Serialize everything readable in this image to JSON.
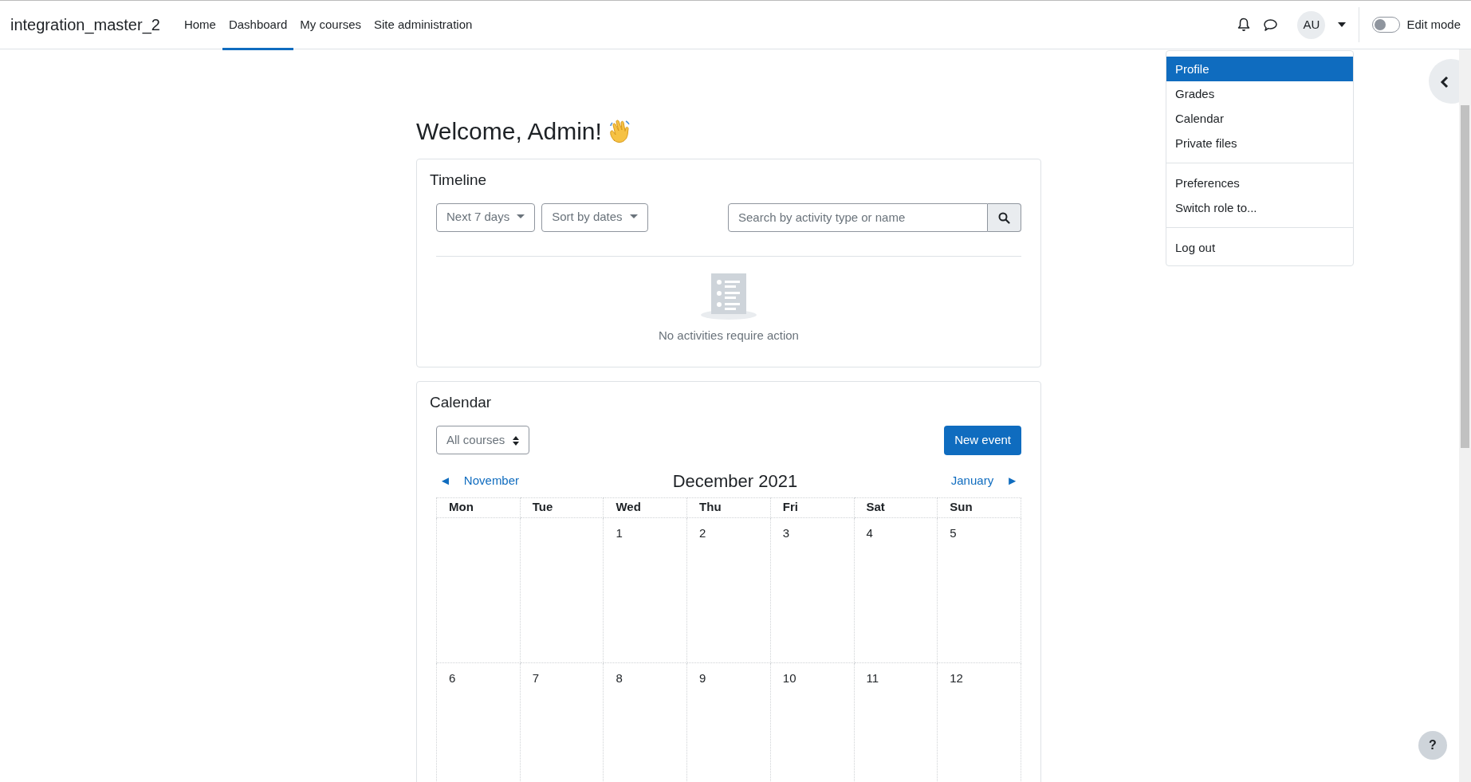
{
  "site_name": "integration_master_2",
  "nav": [
    {
      "label": "Home",
      "selected": false
    },
    {
      "label": "Dashboard",
      "selected": true
    },
    {
      "label": "My courses",
      "selected": false
    },
    {
      "label": "Site administration",
      "selected": false
    }
  ],
  "user": {
    "initials": "AU"
  },
  "edit_mode": {
    "label": "Edit mode",
    "on": false
  },
  "user_menu": {
    "groups": [
      [
        {
          "label": "Profile",
          "selected": true
        },
        {
          "label": "Grades",
          "selected": false
        },
        {
          "label": "Calendar",
          "selected": false
        },
        {
          "label": "Private files",
          "selected": false
        }
      ],
      [
        {
          "label": "Preferences",
          "selected": false
        },
        {
          "label": "Switch role to...",
          "selected": false
        }
      ],
      [
        {
          "label": "Log out",
          "selected": false
        }
      ]
    ]
  },
  "welcome": "Welcome, Admin!",
  "timeline": {
    "title": "Timeline",
    "filters": [
      "Next 7 days",
      "Sort by dates"
    ],
    "search": {
      "placeholder": "Search by activity type or name"
    },
    "empty_message": "No activities require action"
  },
  "calendar": {
    "title": "Calendar",
    "course_select": "All courses",
    "new_event": "New event",
    "prev": {
      "arrow": "◄",
      "label": "November"
    },
    "month": "December 2021",
    "next": {
      "label": "January",
      "arrow": "►"
    },
    "weekdays": [
      "Mon",
      "Tue",
      "Wed",
      "Thu",
      "Fri",
      "Sat",
      "Sun"
    ],
    "weeks": [
      [
        {
          "kind": "blank"
        },
        {
          "kind": "blank"
        },
        {
          "kind": "day",
          "label": "1"
        },
        {
          "kind": "day",
          "label": "2"
        },
        {
          "kind": "day",
          "label": "3"
        },
        {
          "kind": "day",
          "label": "4"
        },
        {
          "kind": "day",
          "label": "5"
        }
      ],
      [
        {
          "kind": "day",
          "label": "6"
        },
        {
          "kind": "day",
          "label": "7"
        },
        {
          "kind": "day",
          "label": "8"
        },
        {
          "kind": "day",
          "label": "9"
        },
        {
          "kind": "day",
          "label": "10"
        },
        {
          "kind": "day",
          "label": "11"
        },
        {
          "kind": "day",
          "label": "12"
        }
      ]
    ]
  },
  "help": "?"
}
